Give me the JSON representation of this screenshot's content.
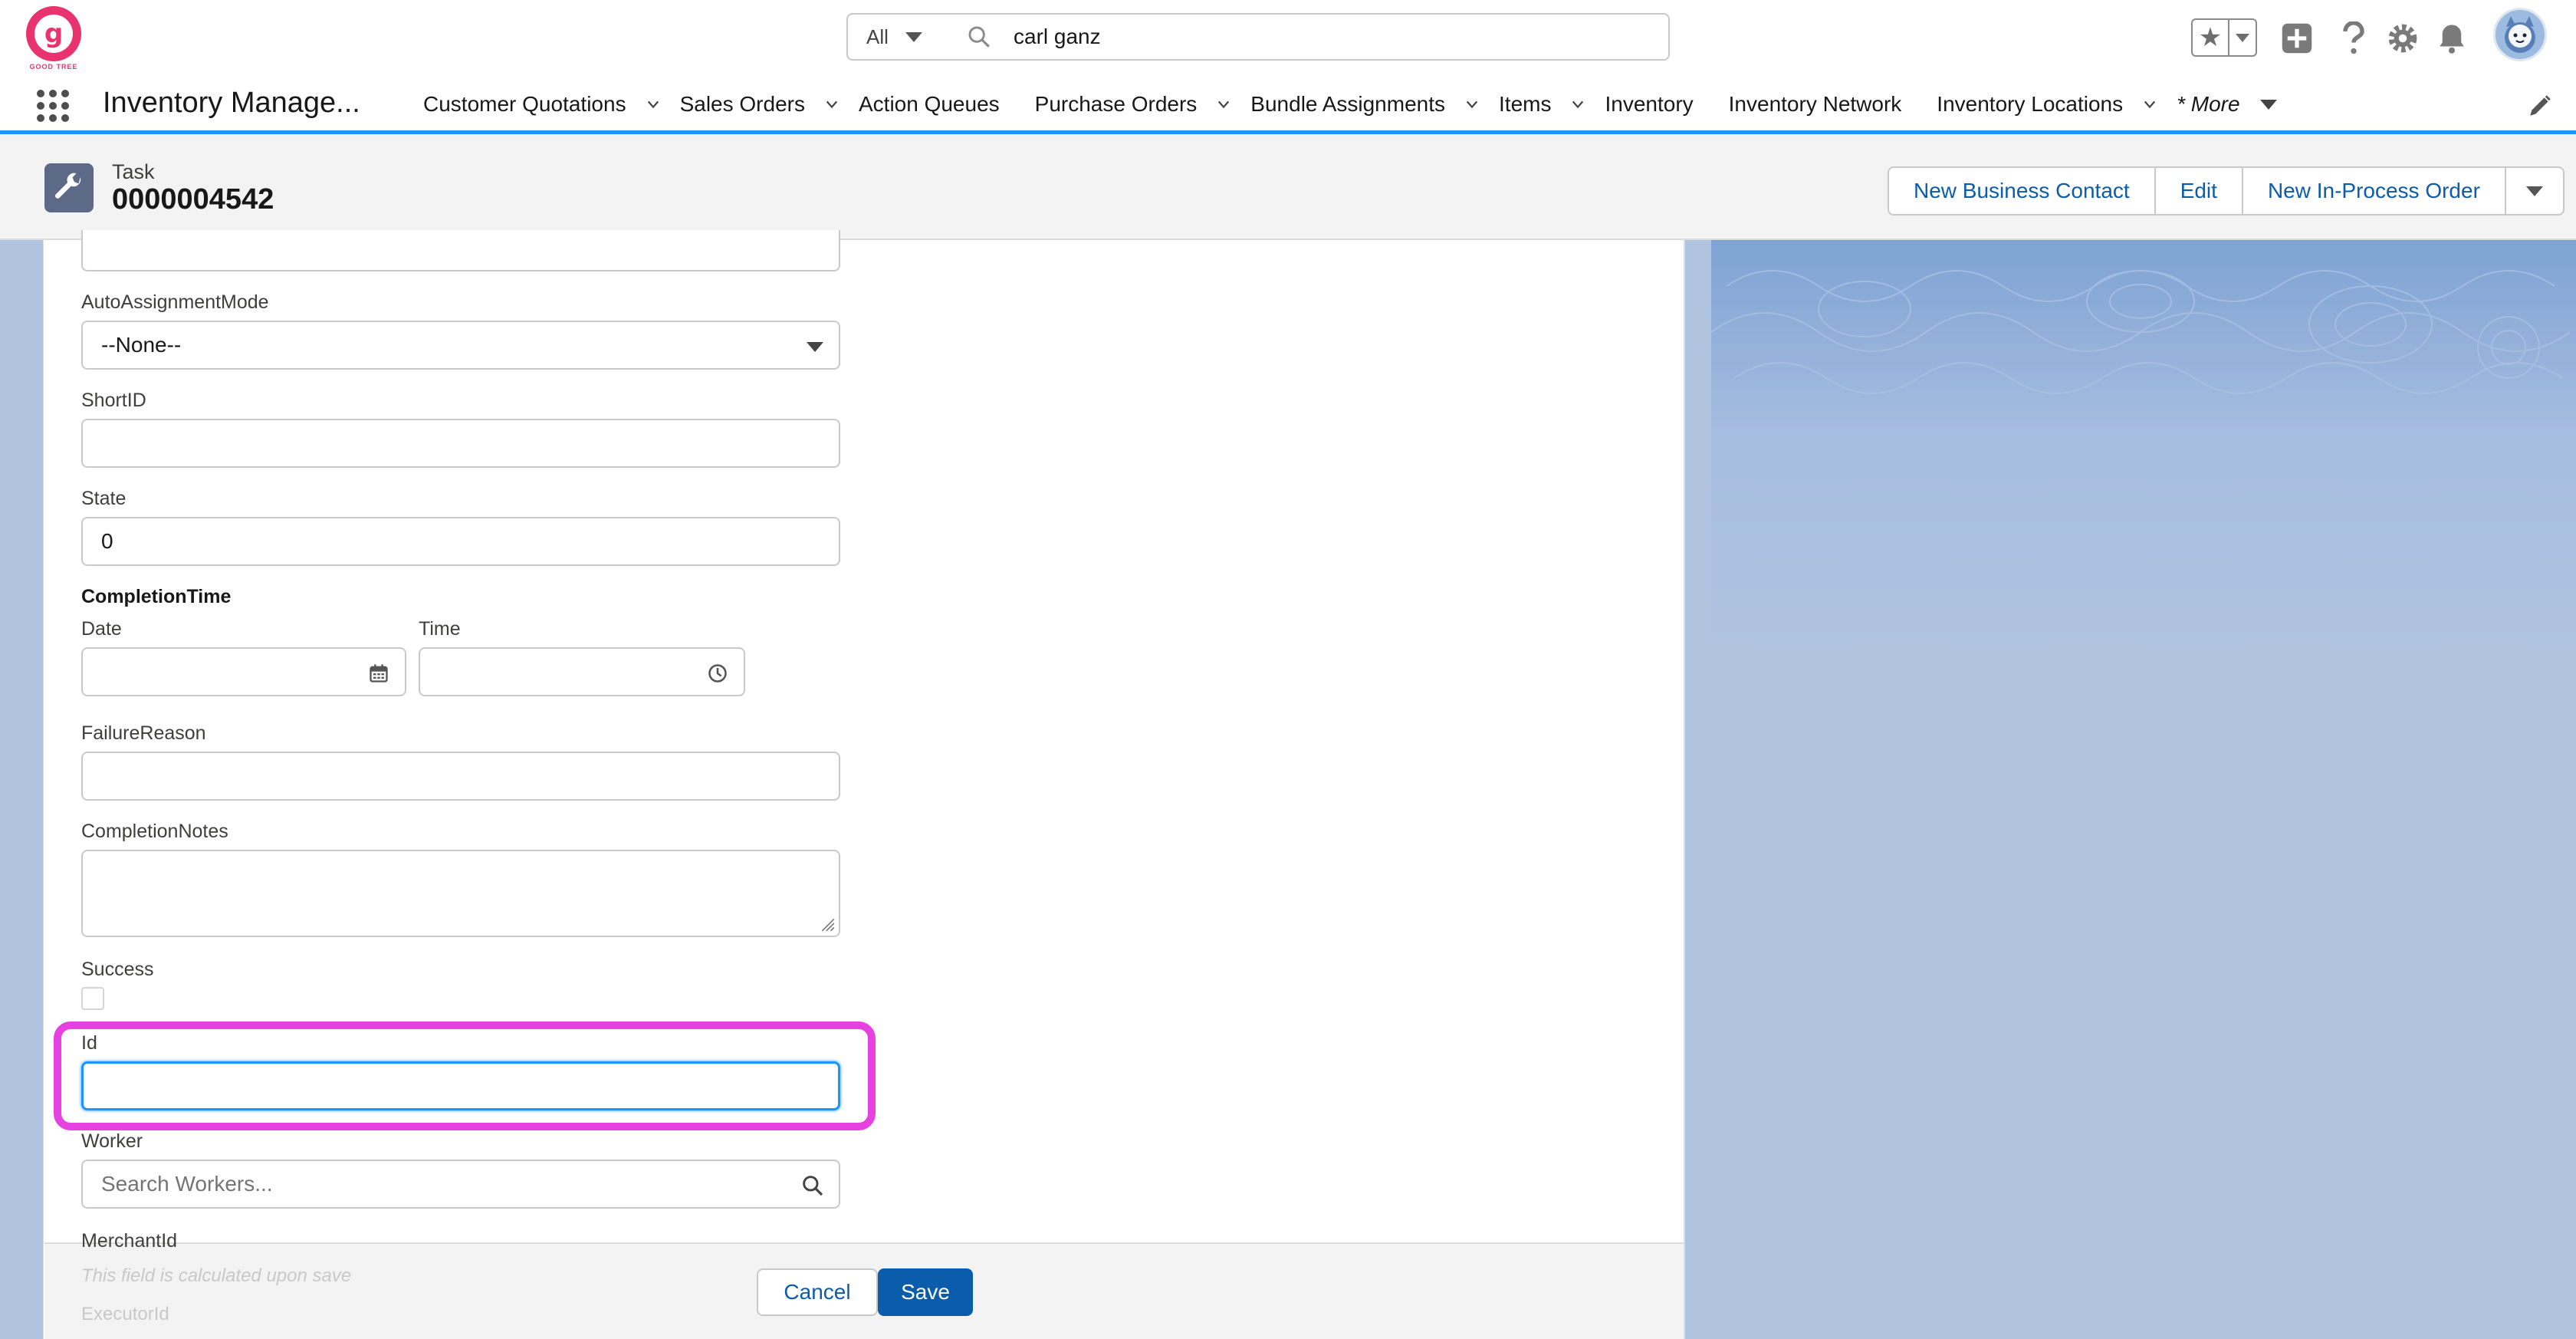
{
  "brand": {
    "logo_letter": "g",
    "logo_text": "GOOD TREE"
  },
  "search": {
    "scope": "All",
    "value": "carl ganz"
  },
  "app": {
    "name": "Inventory Manage..."
  },
  "nav": {
    "items": [
      {
        "label": "Customer Quotations",
        "has_menu": true
      },
      {
        "label": "Sales Orders",
        "has_menu": true
      },
      {
        "label": "Action Queues",
        "has_menu": false
      },
      {
        "label": "Purchase Orders",
        "has_menu": true
      },
      {
        "label": "Bundle Assignments",
        "has_menu": true
      },
      {
        "label": "Items",
        "has_menu": true
      },
      {
        "label": "Inventory",
        "has_menu": false
      },
      {
        "label": "Inventory Network",
        "has_menu": false
      },
      {
        "label": "Inventory Locations",
        "has_menu": true
      }
    ],
    "more_label": "* More"
  },
  "record": {
    "type": "Task",
    "title": "0000004542",
    "actions": [
      "New Business Contact",
      "Edit",
      "New In-Process Order"
    ]
  },
  "form": {
    "auto_assignment_label": "AutoAssignmentMode",
    "auto_assignment_value": "--None--",
    "short_id_label": "ShortID",
    "short_id_value": "",
    "state_label": "State",
    "state_value": "0",
    "completion_time_label": "CompletionTime",
    "date_label": "Date",
    "time_label": "Time",
    "failure_reason_label": "FailureReason",
    "completion_notes_label": "CompletionNotes",
    "success_label": "Success",
    "success_checked": false,
    "id_label": "Id",
    "id_value": "",
    "worker_label": "Worker",
    "worker_placeholder": "Search Workers...",
    "merchant_id_label": "MerchantId",
    "calculated_note": "This field is calculated upon save",
    "executor_id_label": "ExecutorId"
  },
  "footer": {
    "cancel_label": "Cancel",
    "save_label": "Save"
  },
  "colors": {
    "accent": "#1b96ff",
    "brand": "#0b5cab",
    "highlight": "#e641e1",
    "logo": "#e8336f"
  }
}
